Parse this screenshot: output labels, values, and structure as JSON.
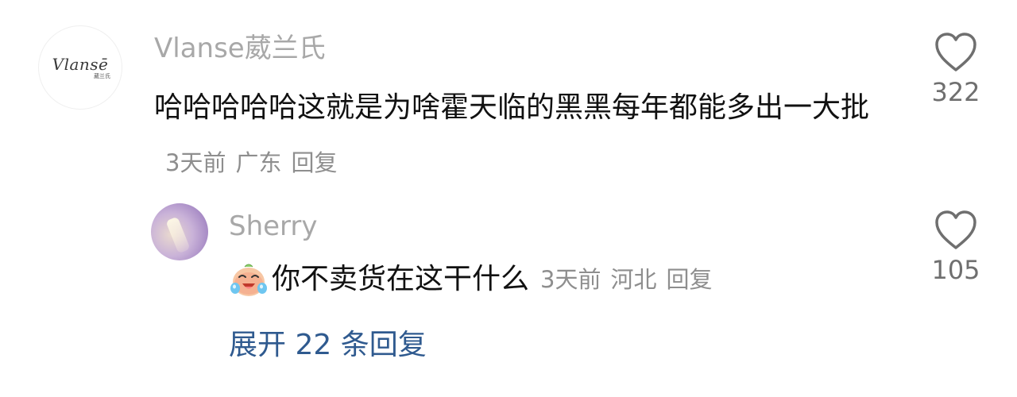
{
  "comment": {
    "avatar": {
      "logo_text": "Vlansē",
      "logo_subtext": "葳兰氏"
    },
    "username": "Vlanse葳兰氏",
    "text": "哈哈哈哈哈这就是为啥霍天临的黑黑每年都能多出一大批",
    "time": "3天前",
    "location": "广东",
    "reply_label": "回复",
    "like_icon": "heart-outline-icon",
    "like_count": "322"
  },
  "reply": {
    "username": "Sherry",
    "emoji_icon": "laughing-crying-emoji-icon",
    "text": "你不卖货在这干什么",
    "time": "3天前",
    "location": "河北",
    "reply_label": "回复",
    "like_icon": "heart-outline-icon",
    "like_count": "105"
  },
  "expand": {
    "label": "展开 22 条回复"
  },
  "colors": {
    "username": "#a8a8a8",
    "meta": "#8e8e8e",
    "link": "#2f5a8f",
    "text": "#111111"
  }
}
